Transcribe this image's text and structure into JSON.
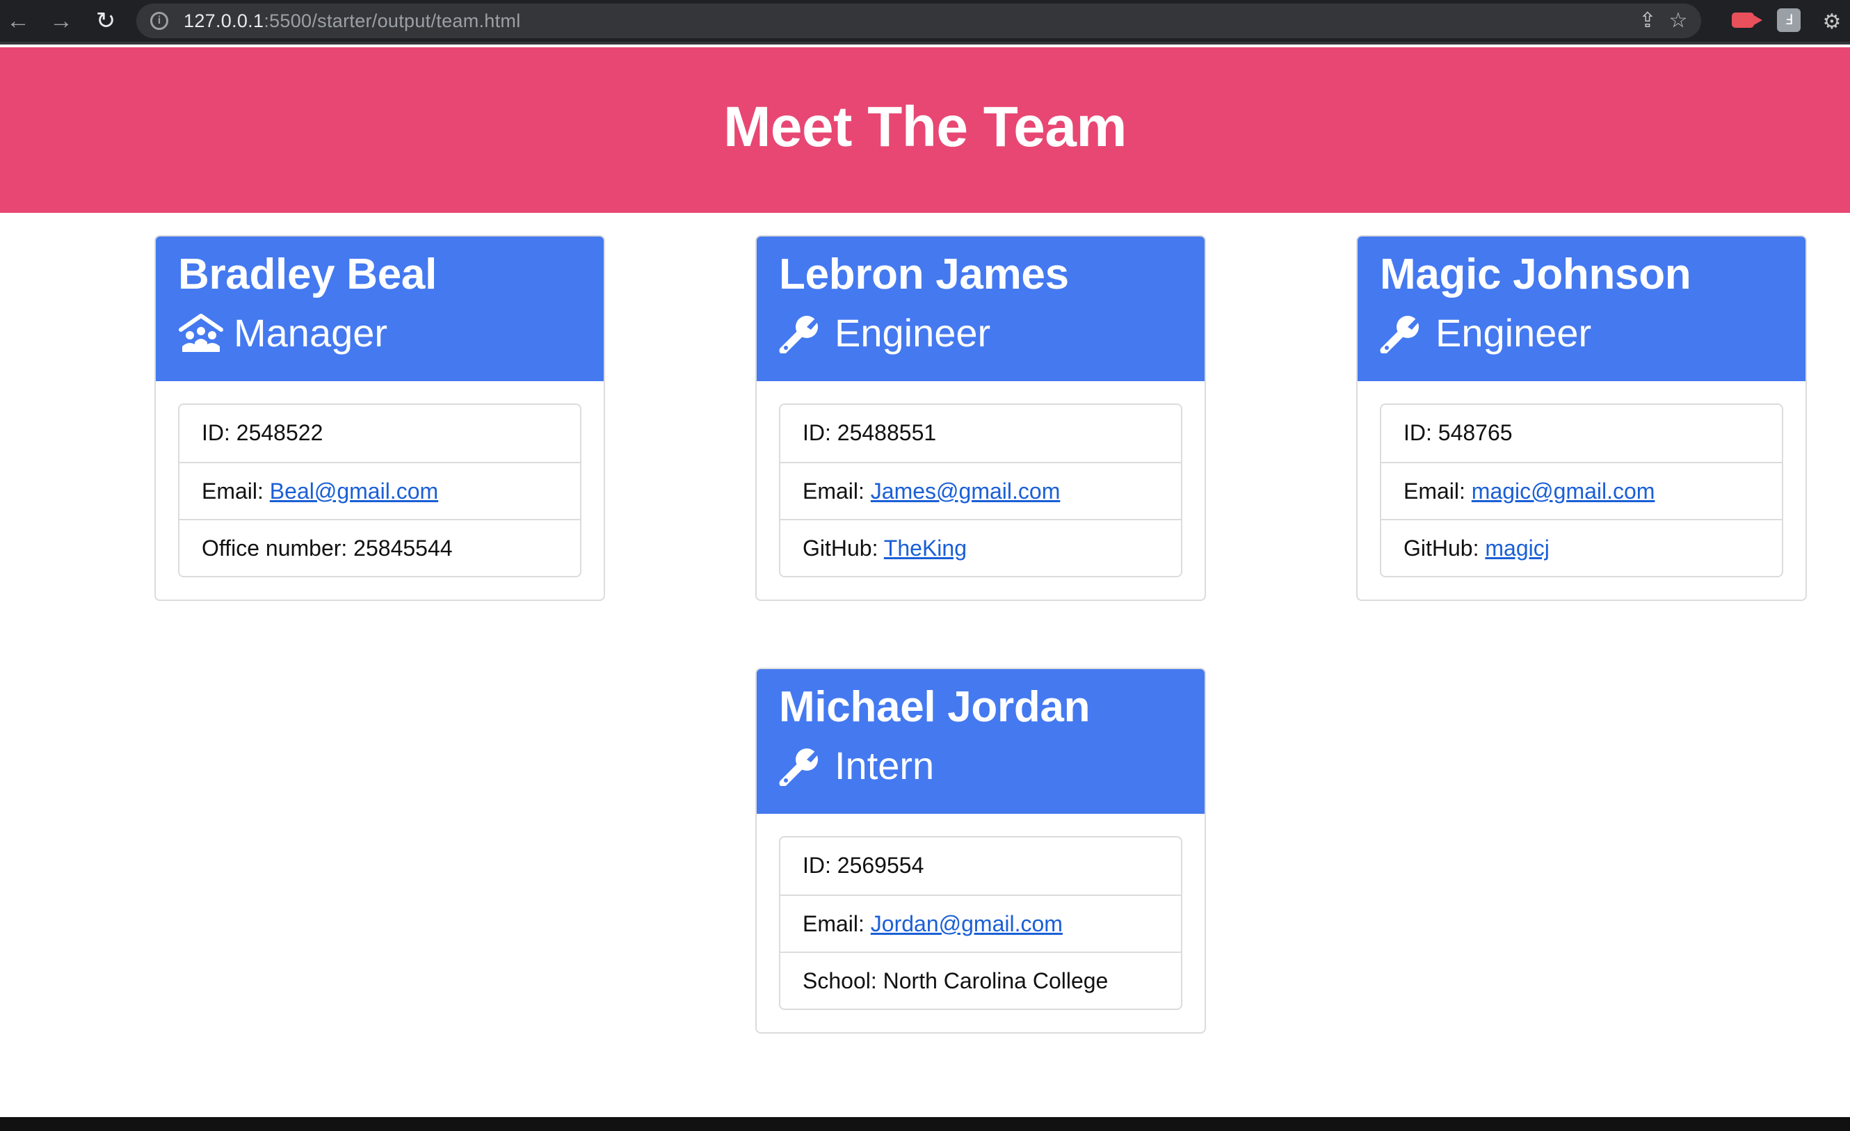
{
  "browser": {
    "url_host": "127.0.0.1",
    "url_path": ":5500/starter/output/team.html"
  },
  "page": {
    "title": "Meet The Team"
  },
  "cards": [
    {
      "name": "Bradley Beal",
      "role": "Manager",
      "role_icon": "people-roof-icon",
      "id_label": "ID:",
      "id": "2548522",
      "email_label": "Email:",
      "email": "Beal@gmail.com",
      "extra_label": "Office number:",
      "extra_value": "25845544"
    },
    {
      "name": "Lebron James",
      "role": "Engineer",
      "role_icon": "wrench-icon",
      "id_label": "ID:",
      "id": "25488551",
      "email_label": "Email:",
      "email": "James@gmail.com",
      "extra_label": "GitHub:",
      "extra_value": "TheKing"
    },
    {
      "name": "Magic Johnson",
      "role": "Engineer",
      "role_icon": "wrench-icon",
      "id_label": "ID:",
      "id": "548765",
      "email_label": "Email:",
      "email": "magic@gmail.com",
      "extra_label": "GitHub:",
      "extra_value": "magicj"
    },
    {
      "name": "Michael Jordan",
      "role": "Intern",
      "role_icon": "wrench-icon",
      "id_label": "ID:",
      "id": "2569554",
      "email_label": "Email:",
      "email": "Jordan@gmail.com",
      "extra_label": "School:",
      "extra_value": "North Carolina College"
    }
  ],
  "colors": {
    "header_bg": "#e84773",
    "card_header_bg": "#4479f0",
    "link": "#1a5fd6"
  }
}
